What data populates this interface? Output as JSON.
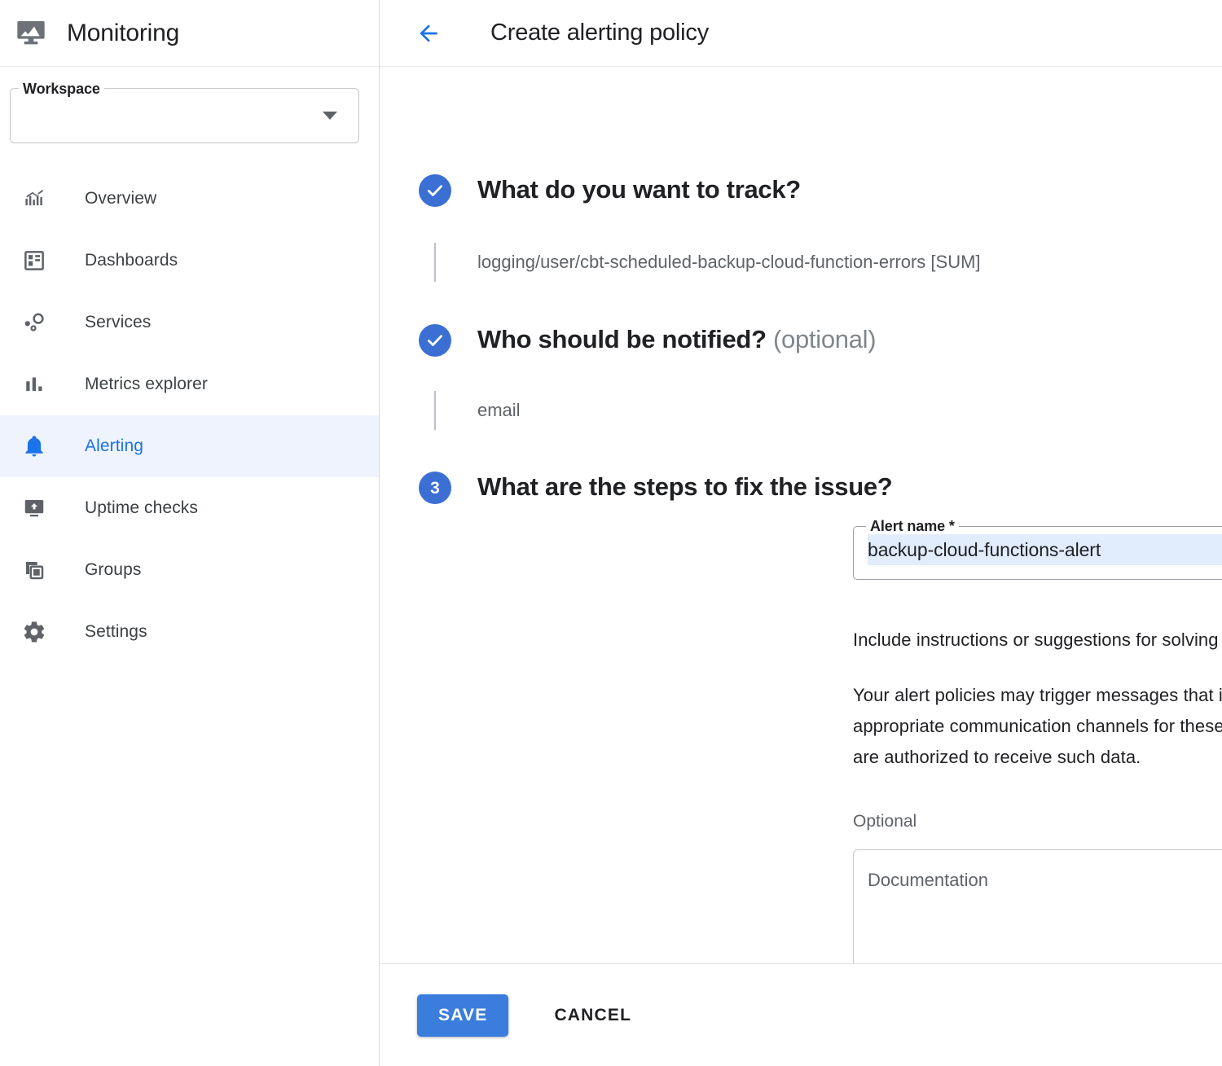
{
  "sidebar": {
    "brand": {
      "title": "Monitoring",
      "logo_icon": "monitor-chart-icon"
    },
    "workspace": {
      "label": "Workspace",
      "value": "",
      "placeholder": "",
      "dropdown_icon": "chevron-down-icon"
    },
    "items": [
      {
        "label": "Overview",
        "icon": "analytics-icon",
        "active": false
      },
      {
        "label": "Dashboards",
        "icon": "dashboard-icon",
        "active": false
      },
      {
        "label": "Services",
        "icon": "services-icon",
        "active": false
      },
      {
        "label": "Metrics explorer",
        "icon": "bar-chart-icon",
        "active": false
      },
      {
        "label": "Alerting",
        "icon": "bell-icon",
        "active": true
      },
      {
        "label": "Uptime checks",
        "icon": "uptime-icon",
        "active": false
      },
      {
        "label": "Groups",
        "icon": "groups-icon",
        "active": false
      },
      {
        "label": "Settings",
        "icon": "gear-icon",
        "active": false
      }
    ]
  },
  "header": {
    "back_icon": "arrow-left-icon",
    "title": "Create alerting policy"
  },
  "steps": {
    "step1": {
      "marker": "check",
      "title": "What do you want to track?",
      "value": "logging/user/cbt-scheduled-backup-cloud-function-errors [SUM]"
    },
    "step2": {
      "marker": "check",
      "title": "Who should be notified?",
      "title_suffix": "(optional)",
      "value": "email"
    },
    "step3": {
      "marker": "3",
      "title": "What are the steps to fix the issue?",
      "alert_name": {
        "label": "Alert name *",
        "value": "backup-cloud-functions-alert",
        "selected": true
      },
      "paragraph1": "Include instructions or suggestions for solving the problem.",
      "paragraph2": "Your alert policies may trigger messages that include personal data. Please use appropriate communication channels for these alerts and confirm that the alert recipients are authorized to receive such data.",
      "optional_label": "Optional",
      "documentation": {
        "placeholder": "Documentation",
        "value": "",
        "help_icon": "help-circle-icon",
        "resize_icon": "resize-handle-icon"
      }
    }
  },
  "actions": {
    "save_label": "SAVE",
    "cancel_label": "CANCEL"
  },
  "colors": {
    "accent": "#1a73e8",
    "step_marker": "#3b6fd4",
    "save_button": "#3b7ddd",
    "active_nav_bg": "#eef3fd",
    "selection_bg": "#e1ecfc"
  }
}
